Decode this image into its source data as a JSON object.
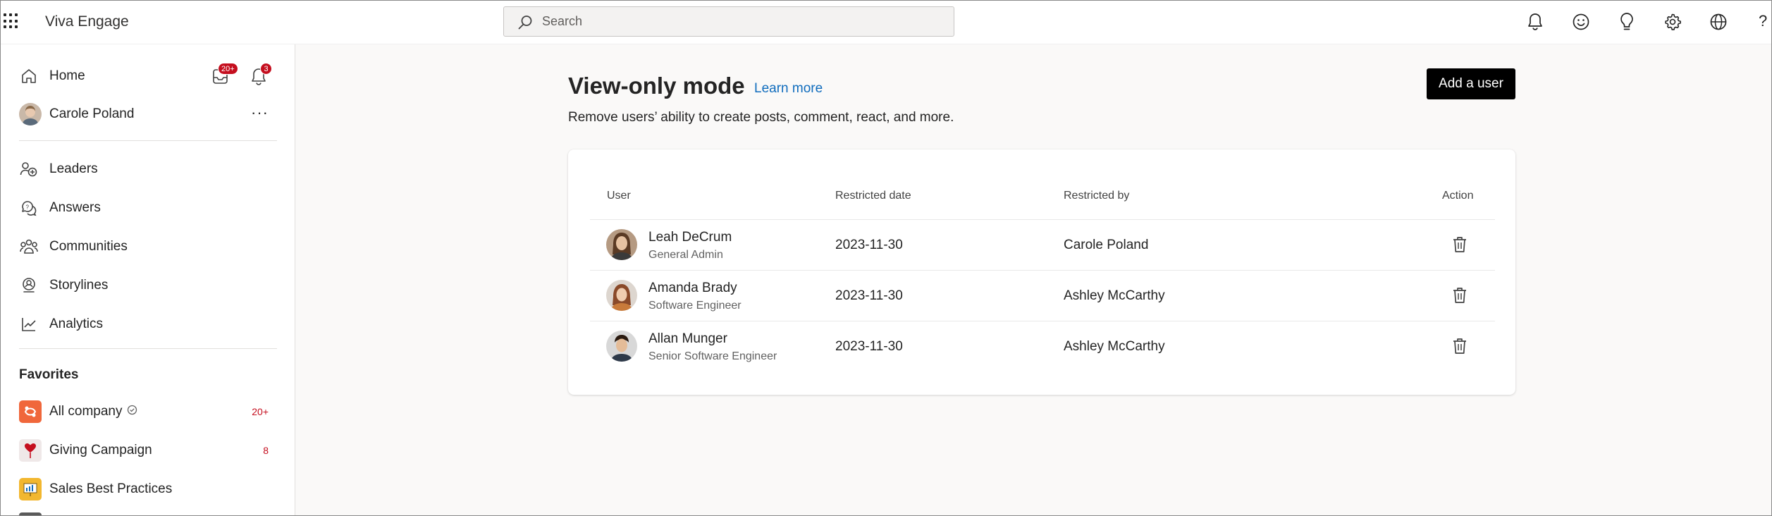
{
  "app": {
    "title": "Viva Engage"
  },
  "search": {
    "placeholder": "Search"
  },
  "top_icons": [
    "bell-icon",
    "emoji-icon",
    "lightbulb-icon",
    "gear-icon",
    "globe-icon"
  ],
  "help_label": "?",
  "sidebar": {
    "home_label": "Home",
    "inbox_badge": "20+",
    "notifications_badge": "3",
    "user_name": "Carole Poland",
    "more_label": "···",
    "nav": [
      {
        "label": "Leaders",
        "icon": "leaders-icon"
      },
      {
        "label": "Answers",
        "icon": "answers-icon"
      },
      {
        "label": "Communities",
        "icon": "communities-icon"
      },
      {
        "label": "Storylines",
        "icon": "storylines-icon"
      },
      {
        "label": "Analytics",
        "icon": "analytics-icon"
      }
    ],
    "favorites_title": "Favorites",
    "favorites": [
      {
        "label": "All company",
        "count": "20+",
        "color": "#f0673b"
      },
      {
        "label": "Giving Campaign",
        "count": "8",
        "color": "#efe8e8"
      },
      {
        "label": "Sales Best Practices",
        "count": "",
        "color": "#f2b72f"
      }
    ]
  },
  "main": {
    "title": "View-only mode",
    "learn_more": "Learn more",
    "subtitle": "Remove users’ ability to create posts, comment, react, and more.",
    "add_user": "Add a user",
    "table": {
      "headers": {
        "user": "User",
        "date": "Restricted date",
        "by": "Restricted by",
        "action": "Action"
      },
      "rows": [
        {
          "name": "Leah DeCrum",
          "role": "General Admin",
          "date": "2023-11-30",
          "by": "Carole Poland"
        },
        {
          "name": "Amanda Brady",
          "role": "Software Engineer",
          "date": "2023-11-30",
          "by": "Ashley McCarthy"
        },
        {
          "name": "Allan Munger",
          "role": "Senior Software Engineer",
          "date": "2023-11-30",
          "by": "Ashley McCarthy"
        }
      ]
    }
  },
  "colors": {
    "accent": "#0f6cbd",
    "badge": "#c50f1f",
    "primary_button": "#000000"
  }
}
